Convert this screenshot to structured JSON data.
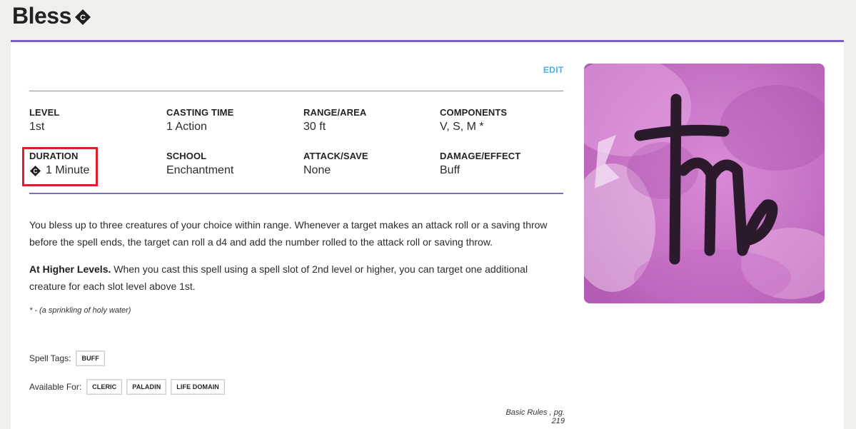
{
  "header": {
    "title": "Bless",
    "title_icon": "concentration-icon"
  },
  "card": {
    "edit_label": "EDIT",
    "stats": [
      {
        "label": "LEVEL",
        "value": "1st"
      },
      {
        "label": "CASTING TIME",
        "value": "1 Action"
      },
      {
        "label": "RANGE/AREA",
        "value": "30 ft"
      },
      {
        "label": "COMPONENTS",
        "value": "V, S, M *"
      },
      {
        "label": "DURATION",
        "value": "1 Minute",
        "icon": "concentration-icon"
      },
      {
        "label": "SCHOOL",
        "value": "Enchantment"
      },
      {
        "label": "ATTACK/SAVE",
        "value": "None"
      },
      {
        "label": "DAMAGE/EFFECT",
        "value": "Buff"
      }
    ],
    "description": "You bless up to three creatures of your choice within range. Whenever a target makes an attack roll or a saving throw before the spell ends, the target can roll a d4 and add the number rolled to the attack roll or saving throw.",
    "higher_levels_label": "At Higher Levels.",
    "higher_levels_text": " When you cast this spell using a spell slot of 2nd level or higher, you can target one additional creature for each slot level above 1st.",
    "material_note": "* - (a sprinkling of holy water)",
    "spell_tags_label": "Spell Tags:",
    "spell_tags": [
      "BUFF"
    ],
    "available_for_label": "Available For:",
    "available_for": [
      "CLERIC",
      "PALADIN",
      "LIFE DOMAIN"
    ],
    "source": "Basic Rules , pg. 219",
    "art_icon": "enchantment-school-icon"
  },
  "colors": {
    "accent_purple": "#7a5ec4",
    "edit_blue": "#41b4e5",
    "highlight_red": "#d6202b",
    "art_pink": "#c86bc8"
  }
}
